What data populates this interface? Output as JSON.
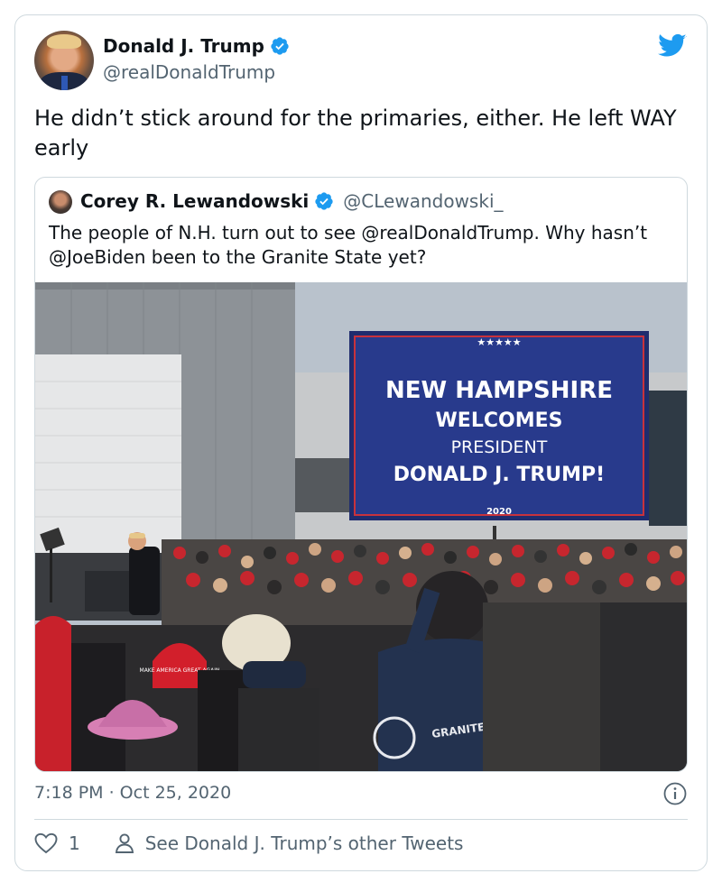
{
  "tweet": {
    "author_name": "Donald J. Trump",
    "author_handle": "@realDonaldTrump",
    "text": "He didn’t stick around for the primaries, either. He left WAY early",
    "timestamp": "7:18 PM · Oct 25, 2020",
    "like_count": "1",
    "see_more_label": "See Donald J. Trump’s other Tweets"
  },
  "quoted_tweet": {
    "author_name": "Corey R. Lewandowski",
    "author_handle": "@CLewandowski_",
    "text": "The people of N.H. turn out to see @realDonaldTrump.  Why hasn’t @JoeBiden been to the Granite State yet?",
    "photo": {
      "screen_stars": "★★★★★",
      "screen_line1": "NEW HAMPSHIRE",
      "screen_line2": "WELCOMES",
      "screen_line3": "PRESIDENT",
      "screen_line4": "DONALD J. TRUMP!",
      "screen_year": "2020",
      "hat_text": "MAKE AMERICA GREAT AGAIN",
      "hoodie_text": "GRANITE STATE GLASS"
    }
  },
  "icons": {
    "verified": "verified-badge-icon",
    "bird": "twitter-bird-icon",
    "info": "info-icon",
    "like": "heart-icon",
    "profile": "person-icon"
  },
  "colors": {
    "brand_blue": "#1d9bf0",
    "text_primary": "#0f1419",
    "text_secondary": "#536471",
    "border": "#cfd9de",
    "screen_navy": "#283a8c",
    "hat_red": "#d21f2b"
  }
}
